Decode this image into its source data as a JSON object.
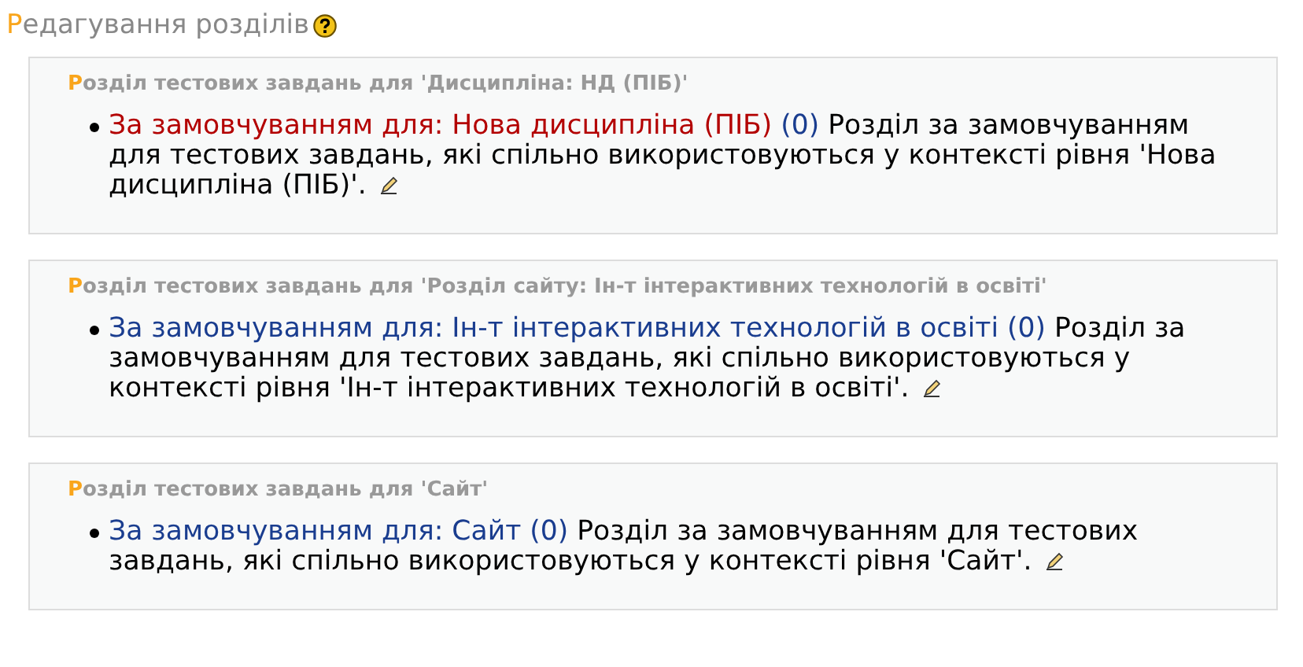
{
  "title": "Редагування розділів",
  "sections": [
    {
      "heading": "Розділ тестових завдань для 'Дисципліна: НД (ПІБ)'",
      "items": [
        {
          "name": "За замовчуванням для: Нова дисципліна (ПІБ)",
          "selected": true,
          "count": "(0)",
          "description": "Розділ за замовчуванням для тестових завдань, які спільно використовуються у контексті рівня 'Нова дисципліна (ПІБ)'."
        }
      ]
    },
    {
      "heading": "Розділ тестових завдань для 'Розділ сайту: Ін-т інтерактивних технологій в освіті'",
      "items": [
        {
          "name": "За замовчуванням для: Ін-т інтерактивних технологій в освіті",
          "selected": false,
          "count": "(0)",
          "description": "Розділ за замовчуванням для тестових завдань, які спільно використовуються у контексті рівня 'Ін-т інтерактивних технологій в освіті'."
        }
      ]
    },
    {
      "heading": "Розділ тестових завдань для 'Сайт'",
      "items": [
        {
          "name": "За замовчуванням для: Сайт",
          "selected": false,
          "count": "(0)",
          "description": "Розділ за замовчуванням для тестових завдань, які спільно використовуються у контексті рівня 'Сайт'."
        }
      ]
    }
  ]
}
